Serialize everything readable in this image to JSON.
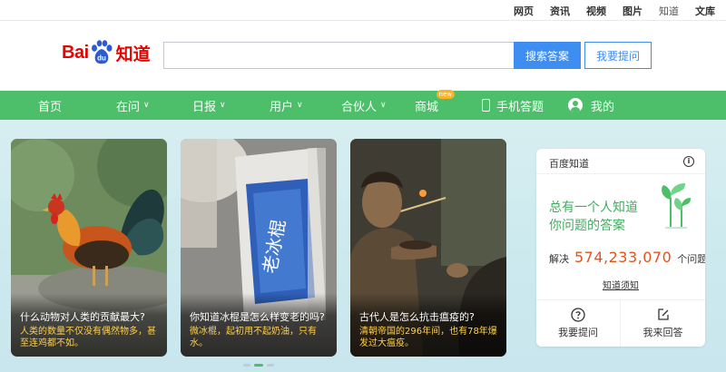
{
  "top_links": [
    "网页",
    "资讯",
    "视频",
    "图片",
    "知道",
    "文库"
  ],
  "logo": {
    "left": "Bai",
    "paw_text": "du",
    "right": "知道",
    "color": "#e10602"
  },
  "search": {
    "value": "",
    "placeholder": "",
    "button": "搜索答案",
    "ask_button": "我要提问"
  },
  "nav": {
    "items": [
      {
        "label": "首页",
        "chevron": false
      },
      {
        "label": "在问",
        "chevron": true
      },
      {
        "label": "日报",
        "chevron": true
      },
      {
        "label": "用户",
        "chevron": true
      },
      {
        "label": "合伙人",
        "chevron": true
      },
      {
        "label": "商城",
        "chevron": false,
        "badge": "new"
      },
      {
        "label": "手机答题",
        "icon": "phone-icon"
      },
      {
        "label": "我的",
        "icon": "user-icon"
      }
    ],
    "color": "#4dbe6a"
  },
  "cards": [
    {
      "title": "什么动物对人类的贡献最大?",
      "desc": "人类的数量不仅没有偶然物多，甚至连鸡都不如。"
    },
    {
      "title": "你知道冰棍是怎么样变老的吗?",
      "desc": "微冰棍，起初用不起奶油，只有水。"
    },
    {
      "title": "古代人是怎么抗击瘟疫的?",
      "desc": "清朝帝国的296年间，也有78年爆发过大瘟疫。"
    }
  ],
  "popsicle_wrapper_text": "老冰棍",
  "carousel": {
    "count": 3,
    "active": 1
  },
  "side_panel": {
    "title": "百度知道",
    "slogan_line1": "总有一个人知道",
    "slogan_line2": "你问题的答案",
    "solved_label": "解决",
    "solved_count": "574,233,070",
    "solved_unit": "个问题",
    "guide_link": "知道须知",
    "actions": [
      {
        "label": "我要提问",
        "icon": "question-circle-icon"
      },
      {
        "label": "我来回答",
        "icon": "edit-icon"
      }
    ],
    "accent": "#3fae5e",
    "number_color": "#e0541c"
  }
}
